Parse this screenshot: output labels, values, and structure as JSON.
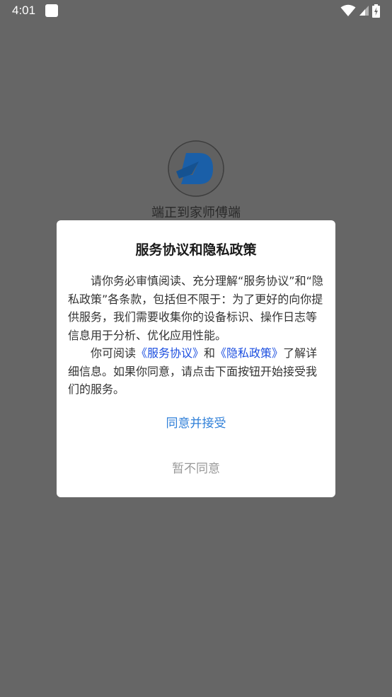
{
  "status_bar": {
    "time": "4:01",
    "icons": [
      "notification-square-icon",
      "wifi-icon",
      "cellular-signal-icon",
      "battery-charging-icon"
    ]
  },
  "splash": {
    "app_name": "端正到家师傅端",
    "logo_icon": "d-logo-icon"
  },
  "dialog": {
    "title": "服务协议和隐私政策",
    "paragraph1": "请你务必审慎阅读、充分理解“服务协议”和“隐私政策”各条款，包括但不限于：为了更好的向你提供服务，我们需要收集你的设备标识、操作日志等信息用于分析、优化应用性能。",
    "paragraph2": {
      "prefix": "你可阅读",
      "link1": "《服务协议》",
      "and": "和",
      "link2": "《隐私政策》",
      "suffix": "了解详细信息。如果你同意，请点击下面按钮开始接受我们的服务。"
    },
    "agree_label": "同意并接受",
    "disagree_label": "暂不同意"
  },
  "colors": {
    "overlay": "#666666",
    "dialog_bg": "#ffffff",
    "link": "#1c4fe0",
    "agree": "#2f7fd8",
    "disagree": "#999999",
    "logo_blue": "#1d7ad6"
  }
}
